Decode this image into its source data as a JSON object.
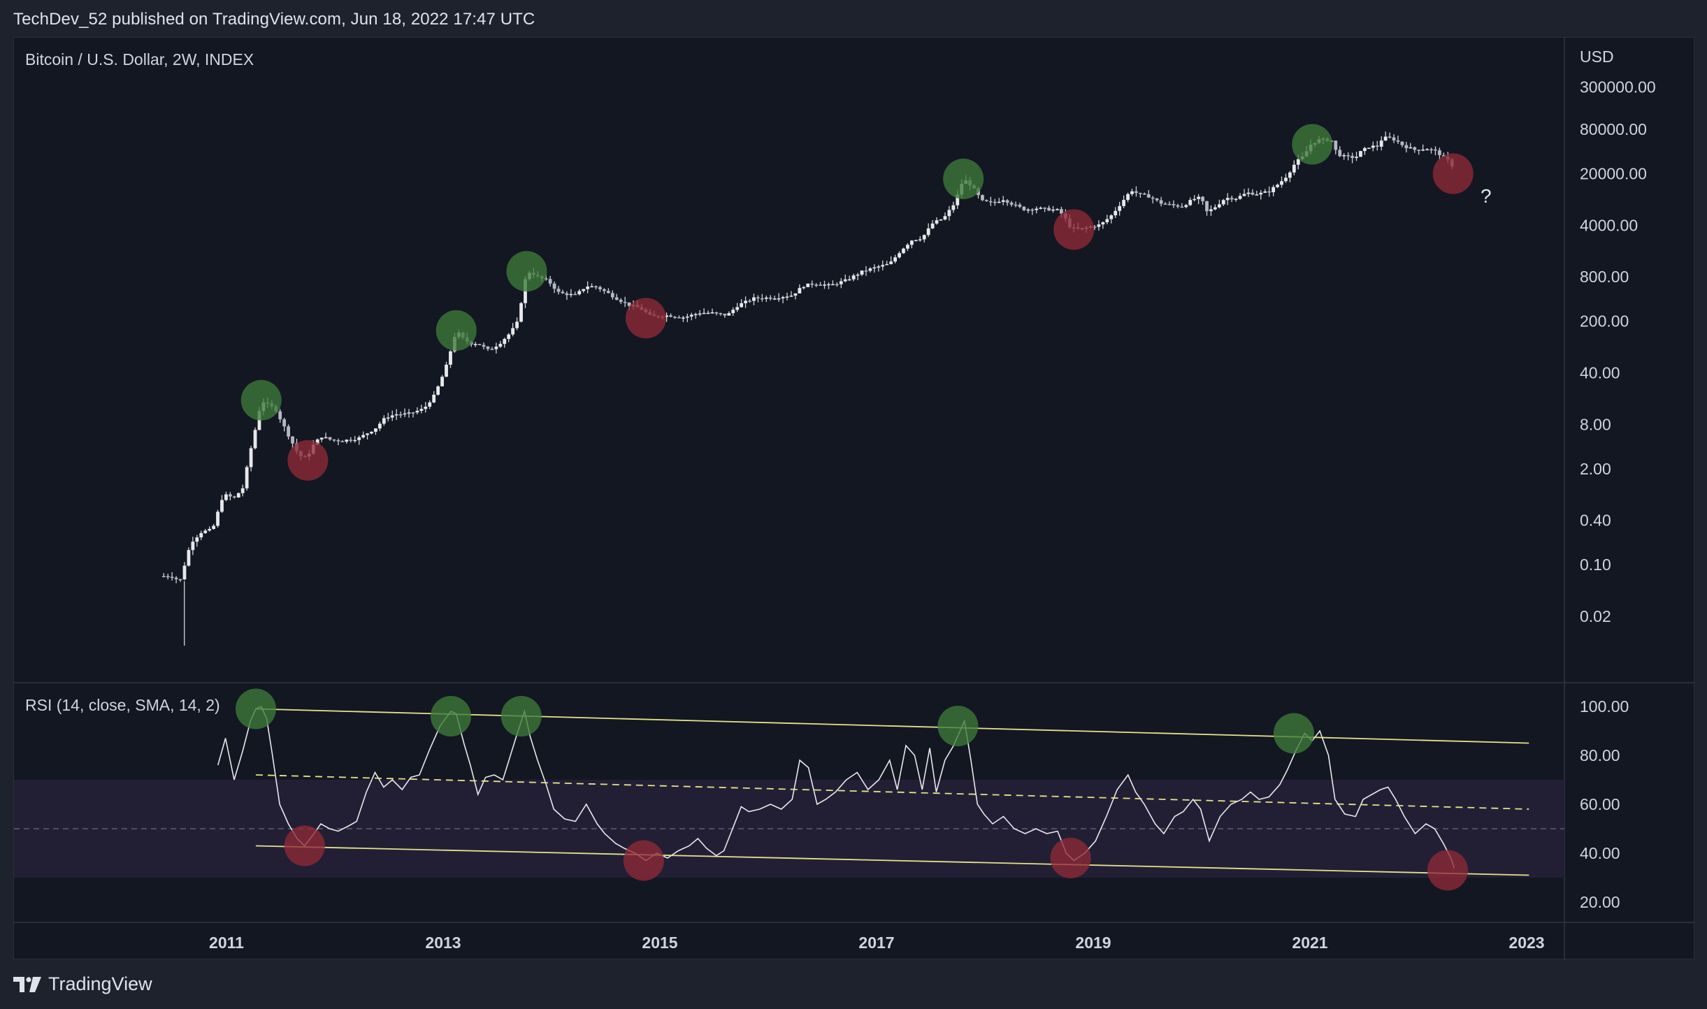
{
  "header": {
    "attribution": "TechDev_52 published on TradingView.com, Jun 18, 2022 17:47 UTC"
  },
  "footer": {
    "brand": "TradingView"
  },
  "colors": {
    "background": "#131722",
    "grid": "#2a2e39",
    "candle": "#d1d4dc",
    "rsi_line": "#e8e8ea",
    "channel": "#e6e38c",
    "band_fill": "#221f35",
    "peak_marker": "#3d7a3a",
    "trough_marker": "#8e2a37"
  },
  "chart_data": [
    {
      "type": "candlestick",
      "title": "Bitcoin / U.S. Dollar, 2W, INDEX",
      "currency": "USD",
      "y_scale": "log",
      "y_ticks": [
        "300000.00",
        "80000.00",
        "20000.00",
        "4000.00",
        "800.00",
        "200.00",
        "40.00",
        "8.00",
        "2.00",
        "0.40",
        "0.10",
        "0.02"
      ],
      "x_ticks": [
        "2011",
        "2013",
        "2015",
        "2017",
        "2019",
        "2021",
        "2023"
      ],
      "close_path": [
        [
          2010.55,
          0.07
        ],
        [
          2010.62,
          0.07
        ],
        [
          2010.7,
          0.06
        ],
        [
          2010.8,
          0.2
        ],
        [
          2010.9,
          0.28
        ],
        [
          2011.0,
          0.3
        ],
        [
          2011.1,
          0.9
        ],
        [
          2011.2,
          0.8
        ],
        [
          2011.28,
          1.1
        ],
        [
          2011.35,
          3.5
        ],
        [
          2011.42,
          10
        ],
        [
          2011.45,
          17
        ],
        [
          2011.5,
          15
        ],
        [
          2011.58,
          13
        ],
        [
          2011.65,
          8
        ],
        [
          2011.72,
          5
        ],
        [
          2011.8,
          3
        ],
        [
          2011.87,
          2.8
        ],
        [
          2011.92,
          4
        ],
        [
          2012.0,
          5.5
        ],
        [
          2012.1,
          4.9
        ],
        [
          2012.2,
          4.8
        ],
        [
          2012.35,
          5.2
        ],
        [
          2012.5,
          7
        ],
        [
          2012.6,
          10
        ],
        [
          2012.7,
          11
        ],
        [
          2012.8,
          11
        ],
        [
          2012.95,
          13
        ],
        [
          2013.05,
          20
        ],
        [
          2013.15,
          45
        ],
        [
          2013.25,
          150
        ],
        [
          2013.3,
          120
        ],
        [
          2013.38,
          100
        ],
        [
          2013.45,
          100
        ],
        [
          2013.55,
          80
        ],
        [
          2013.65,
          100
        ],
        [
          2013.75,
          140
        ],
        [
          2013.82,
          200
        ],
        [
          2013.88,
          700
        ],
        [
          2013.93,
          950
        ],
        [
          2014.0,
          800
        ],
        [
          2014.1,
          700
        ],
        [
          2014.2,
          480
        ],
        [
          2014.35,
          450
        ],
        [
          2014.45,
          600
        ],
        [
          2014.55,
          580
        ],
        [
          2014.65,
          480
        ],
        [
          2014.75,
          390
        ],
        [
          2014.85,
          330
        ],
        [
          2014.95,
          300
        ],
        [
          2015.05,
          230
        ],
        [
          2015.2,
          240
        ],
        [
          2015.35,
          225
        ],
        [
          2015.5,
          260
        ],
        [
          2015.6,
          260
        ],
        [
          2015.75,
          240
        ],
        [
          2015.85,
          330
        ],
        [
          2016.0,
          410
        ],
        [
          2016.2,
          420
        ],
        [
          2016.35,
          450
        ],
        [
          2016.45,
          600
        ],
        [
          2016.55,
          650
        ],
        [
          2016.7,
          610
        ],
        [
          2016.85,
          720
        ],
        [
          2017.0,
          950
        ],
        [
          2017.15,
          1100
        ],
        [
          2017.25,
          1200
        ],
        [
          2017.35,
          1800
        ],
        [
          2017.45,
          2500
        ],
        [
          2017.55,
          2700
        ],
        [
          2017.65,
          4300
        ],
        [
          2017.75,
          5000
        ],
        [
          2017.85,
          8000
        ],
        [
          2017.93,
          17000
        ],
        [
          2018.0,
          14000
        ],
        [
          2018.05,
          11000
        ],
        [
          2018.1,
          8500
        ],
        [
          2018.2,
          8000
        ],
        [
          2018.3,
          9000
        ],
        [
          2018.4,
          7500
        ],
        [
          2018.5,
          6500
        ],
        [
          2018.6,
          6800
        ],
        [
          2018.7,
          6600
        ],
        [
          2018.8,
          6400
        ],
        [
          2018.85,
          5500
        ],
        [
          2018.92,
          3700
        ],
        [
          2019.0,
          3500
        ],
        [
          2019.1,
          3800
        ],
        [
          2019.2,
          4100
        ],
        [
          2019.3,
          5500
        ],
        [
          2019.4,
          8500
        ],
        [
          2019.48,
          12000
        ],
        [
          2019.55,
          10500
        ],
        [
          2019.65,
          9800
        ],
        [
          2019.75,
          8000
        ],
        [
          2019.85,
          7500
        ],
        [
          2019.95,
          7200
        ],
        [
          2020.05,
          9000
        ],
        [
          2020.12,
          9500
        ],
        [
          2020.18,
          6000
        ],
        [
          2020.25,
          7000
        ],
        [
          2020.35,
          9400
        ],
        [
          2020.45,
          9300
        ],
        [
          2020.55,
          11000
        ],
        [
          2020.65,
          10600
        ],
        [
          2020.75,
          11500
        ],
        [
          2020.85,
          15000
        ],
        [
          2020.92,
          19000
        ],
        [
          2021.0,
          29000
        ],
        [
          2021.08,
          35000
        ],
        [
          2021.12,
          48000
        ],
        [
          2021.2,
          57000
        ],
        [
          2021.28,
          58000
        ],
        [
          2021.33,
          56000
        ],
        [
          2021.38,
          37000
        ],
        [
          2021.45,
          34000
        ],
        [
          2021.55,
          33000
        ],
        [
          2021.6,
          40000
        ],
        [
          2021.68,
          47000
        ],
        [
          2021.75,
          47000
        ],
        [
          2021.8,
          61000
        ],
        [
          2021.85,
          62000
        ],
        [
          2021.92,
          57000
        ],
        [
          2022.0,
          47000
        ],
        [
          2022.1,
          42000
        ],
        [
          2022.2,
          44000
        ],
        [
          2022.3,
          40000
        ],
        [
          2022.38,
          31000
        ],
        [
          2022.43,
          29500
        ],
        [
          2022.46,
          20000
        ]
      ],
      "markers": {
        "peaks": [
          [
            2011.45,
            17
          ],
          [
            2013.25,
            150
          ],
          [
            2013.9,
            950
          ],
          [
            2017.93,
            17000
          ],
          [
            2021.15,
            50000
          ]
        ],
        "troughs": [
          [
            2011.88,
            2.6
          ],
          [
            2015.0,
            220
          ],
          [
            2018.95,
            3500
          ],
          [
            2022.45,
            20000
          ]
        ]
      },
      "annotation": "?"
    },
    {
      "type": "line",
      "title": "RSI (14, close, SMA, 14, 2)",
      "y_ticks": [
        "100.00",
        "80.00",
        "60.00",
        "40.00",
        "20.00"
      ],
      "band": [
        30,
        70
      ],
      "midline": 50,
      "series": [
        {
          "values": [
            [
              2011.05,
              76
            ],
            [
              2011.12,
              87
            ],
            [
              2011.2,
              70
            ],
            [
              2011.28,
              82
            ],
            [
              2011.35,
              94
            ],
            [
              2011.4,
              99
            ],
            [
              2011.45,
              100
            ],
            [
              2011.5,
              95
            ],
            [
              2011.55,
              81
            ],
            [
              2011.62,
              60
            ],
            [
              2011.7,
              52
            ],
            [
              2011.78,
              46
            ],
            [
              2011.85,
              43
            ],
            [
              2011.92,
              47
            ],
            [
              2012.0,
              52
            ],
            [
              2012.08,
              50
            ],
            [
              2012.16,
              49
            ],
            [
              2012.25,
              51
            ],
            [
              2012.33,
              53
            ],
            [
              2012.42,
              65
            ],
            [
              2012.5,
              73
            ],
            [
              2012.58,
              67
            ],
            [
              2012.66,
              70
            ],
            [
              2012.75,
              66
            ],
            [
              2012.83,
              71
            ],
            [
              2012.91,
              72
            ],
            [
              2013.0,
              82
            ],
            [
              2013.1,
              92
            ],
            [
              2013.2,
              98
            ],
            [
              2013.25,
              97
            ],
            [
              2013.32,
              85
            ],
            [
              2013.38,
              76
            ],
            [
              2013.45,
              64
            ],
            [
              2013.52,
              71
            ],
            [
              2013.6,
              72
            ],
            [
              2013.68,
              70
            ],
            [
              2013.75,
              80
            ],
            [
              2013.82,
              90
            ],
            [
              2013.88,
              98
            ],
            [
              2013.93,
              88
            ],
            [
              2014.0,
              78
            ],
            [
              2014.08,
              68
            ],
            [
              2014.15,
              58
            ],
            [
              2014.25,
              54
            ],
            [
              2014.35,
              53
            ],
            [
              2014.45,
              60
            ],
            [
              2014.55,
              52
            ],
            [
              2014.62,
              48
            ],
            [
              2014.72,
              44
            ],
            [
              2014.8,
              42
            ],
            [
              2014.9,
              40
            ],
            [
              2015.0,
              37
            ],
            [
              2015.1,
              40
            ],
            [
              2015.2,
              38
            ],
            [
              2015.3,
              41
            ],
            [
              2015.4,
              43
            ],
            [
              2015.48,
              46
            ],
            [
              2015.56,
              42
            ],
            [
              2015.65,
              39
            ],
            [
              2015.72,
              41
            ],
            [
              2015.8,
              50
            ],
            [
              2015.88,
              59
            ],
            [
              2015.95,
              57
            ],
            [
              2016.05,
              58
            ],
            [
              2016.15,
              60
            ],
            [
              2016.25,
              58
            ],
            [
              2016.35,
              62
            ],
            [
              2016.42,
              78
            ],
            [
              2016.5,
              75
            ],
            [
              2016.58,
              60
            ],
            [
              2016.66,
              62
            ],
            [
              2016.75,
              65
            ],
            [
              2016.85,
              70
            ],
            [
              2016.95,
              73
            ],
            [
              2017.05,
              66
            ],
            [
              2017.15,
              70
            ],
            [
              2017.25,
              78
            ],
            [
              2017.32,
              66
            ],
            [
              2017.4,
              84
            ],
            [
              2017.48,
              80
            ],
            [
              2017.55,
              66
            ],
            [
              2017.62,
              83
            ],
            [
              2017.68,
              65
            ],
            [
              2017.76,
              78
            ],
            [
              2017.84,
              84
            ],
            [
              2017.9,
              90
            ],
            [
              2017.94,
              94
            ],
            [
              2018.0,
              78
            ],
            [
              2018.06,
              60
            ],
            [
              2018.12,
              56
            ],
            [
              2018.2,
              52
            ],
            [
              2018.3,
              55
            ],
            [
              2018.4,
              50
            ],
            [
              2018.5,
              48
            ],
            [
              2018.6,
              50
            ],
            [
              2018.7,
              48
            ],
            [
              2018.8,
              49
            ],
            [
              2018.88,
              40
            ],
            [
              2018.95,
              37
            ],
            [
              2019.05,
              40
            ],
            [
              2019.15,
              45
            ],
            [
              2019.25,
              55
            ],
            [
              2019.35,
              66
            ],
            [
              2019.45,
              72
            ],
            [
              2019.52,
              65
            ],
            [
              2019.6,
              60
            ],
            [
              2019.7,
              52
            ],
            [
              2019.78,
              48
            ],
            [
              2019.88,
              55
            ],
            [
              2019.96,
              57
            ],
            [
              2020.05,
              62
            ],
            [
              2020.12,
              58
            ],
            [
              2020.2,
              45
            ],
            [
              2020.3,
              55
            ],
            [
              2020.4,
              60
            ],
            [
              2020.5,
              62
            ],
            [
              2020.58,
              65
            ],
            [
              2020.66,
              62
            ],
            [
              2020.75,
              63
            ],
            [
              2020.85,
              68
            ],
            [
              2020.92,
              74
            ],
            [
              2021.0,
              82
            ],
            [
              2021.08,
              89
            ],
            [
              2021.15,
              86
            ],
            [
              2021.22,
              90
            ],
            [
              2021.3,
              80
            ],
            [
              2021.36,
              62
            ],
            [
              2021.45,
              56
            ],
            [
              2021.55,
              55
            ],
            [
              2021.62,
              62
            ],
            [
              2021.7,
              64
            ],
            [
              2021.78,
              66
            ],
            [
              2021.85,
              67
            ],
            [
              2021.92,
              62
            ],
            [
              2022.0,
              55
            ],
            [
              2022.1,
              48
            ],
            [
              2022.2,
              52
            ],
            [
              2022.28,
              50
            ],
            [
              2022.36,
              44
            ],
            [
              2022.43,
              38
            ],
            [
              2022.46,
              34
            ]
          ]
        }
      ],
      "channel": {
        "upper": [
          [
            2011.4,
            99
          ],
          [
            2023.15,
            85
          ]
        ],
        "middle_dashed": [
          [
            2011.4,
            72
          ],
          [
            2023.15,
            58
          ]
        ],
        "lower": [
          [
            2011.4,
            43
          ],
          [
            2023.15,
            31
          ]
        ]
      },
      "markers": {
        "peaks": [
          [
            2011.4,
            99
          ],
          [
            2013.2,
            96
          ],
          [
            2013.85,
            96
          ],
          [
            2017.88,
            92
          ],
          [
            2020.98,
            89
          ]
        ],
        "troughs": [
          [
            2011.85,
            43
          ],
          [
            2014.98,
            37
          ],
          [
            2018.92,
            38
          ],
          [
            2022.4,
            33
          ]
        ]
      }
    }
  ]
}
